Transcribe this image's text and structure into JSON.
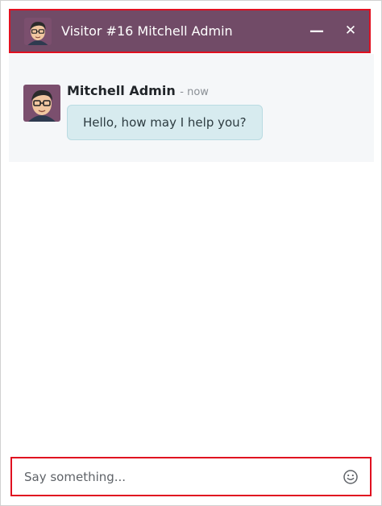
{
  "header": {
    "title": "Visitor #16 Mitchell Admin",
    "minimize_icon": "minus-icon",
    "close_icon": "close-icon",
    "background": "#714b67"
  },
  "thread": {
    "messages": [
      {
        "author": "Mitchell Admin",
        "time": "- now",
        "text": "Hello, how may I help you?"
      }
    ]
  },
  "composer": {
    "placeholder": "Say something...",
    "emoji_icon": "smiley-icon"
  },
  "colors": {
    "header_bg": "#714b67",
    "bubble_bg": "#d7ebef",
    "highlight": "#e01020"
  }
}
